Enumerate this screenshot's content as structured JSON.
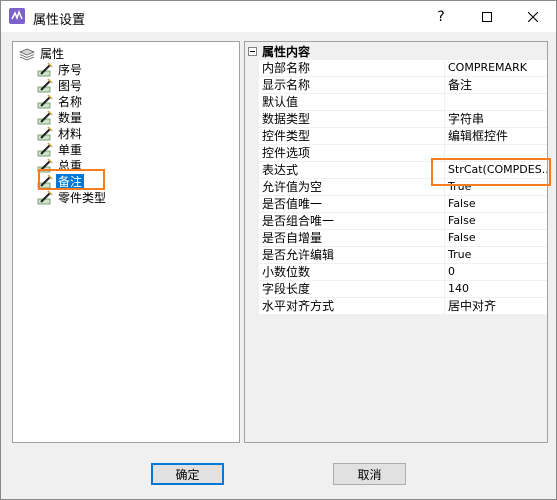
{
  "window": {
    "title": "属性设置",
    "icon": "app-logo-icon"
  },
  "titlebar_buttons": {
    "help": "?",
    "maximize": "maximize-icon",
    "close": "close-icon"
  },
  "tree": {
    "root": "属性",
    "items": [
      "序号",
      "图号",
      "名称",
      "数量",
      "材料",
      "单重",
      "总重",
      "备注",
      "零件类型"
    ],
    "selected": "备注"
  },
  "props": {
    "group": "属性内容",
    "rows": [
      {
        "name": "内部名称",
        "value": "COMPREMARK"
      },
      {
        "name": "显示名称",
        "value": "备注"
      },
      {
        "name": "默认值",
        "value": ""
      },
      {
        "name": "数据类型",
        "value": "字符串"
      },
      {
        "name": "控件类型",
        "value": "编辑框控件"
      },
      {
        "name": "控件选项",
        "value": ""
      },
      {
        "name": "表达式",
        "value": "StrCat(COMPDES..."
      },
      {
        "name": "允许值为空",
        "value": "True"
      },
      {
        "name": "是否值唯一",
        "value": "False"
      },
      {
        "name": "是否组合唯一",
        "value": "False"
      },
      {
        "name": "是否自增量",
        "value": "False"
      },
      {
        "name": "是否允许编辑",
        "value": "True"
      },
      {
        "name": "小数位数",
        "value": "0"
      },
      {
        "name": "字段长度",
        "value": "140"
      },
      {
        "name": "水平对齐方式",
        "value": "居中对齐"
      }
    ]
  },
  "buttons": {
    "ok": "确定",
    "cancel": "取消"
  },
  "colors": {
    "selection": "#0078d7",
    "highlight": "#f57c1f"
  }
}
